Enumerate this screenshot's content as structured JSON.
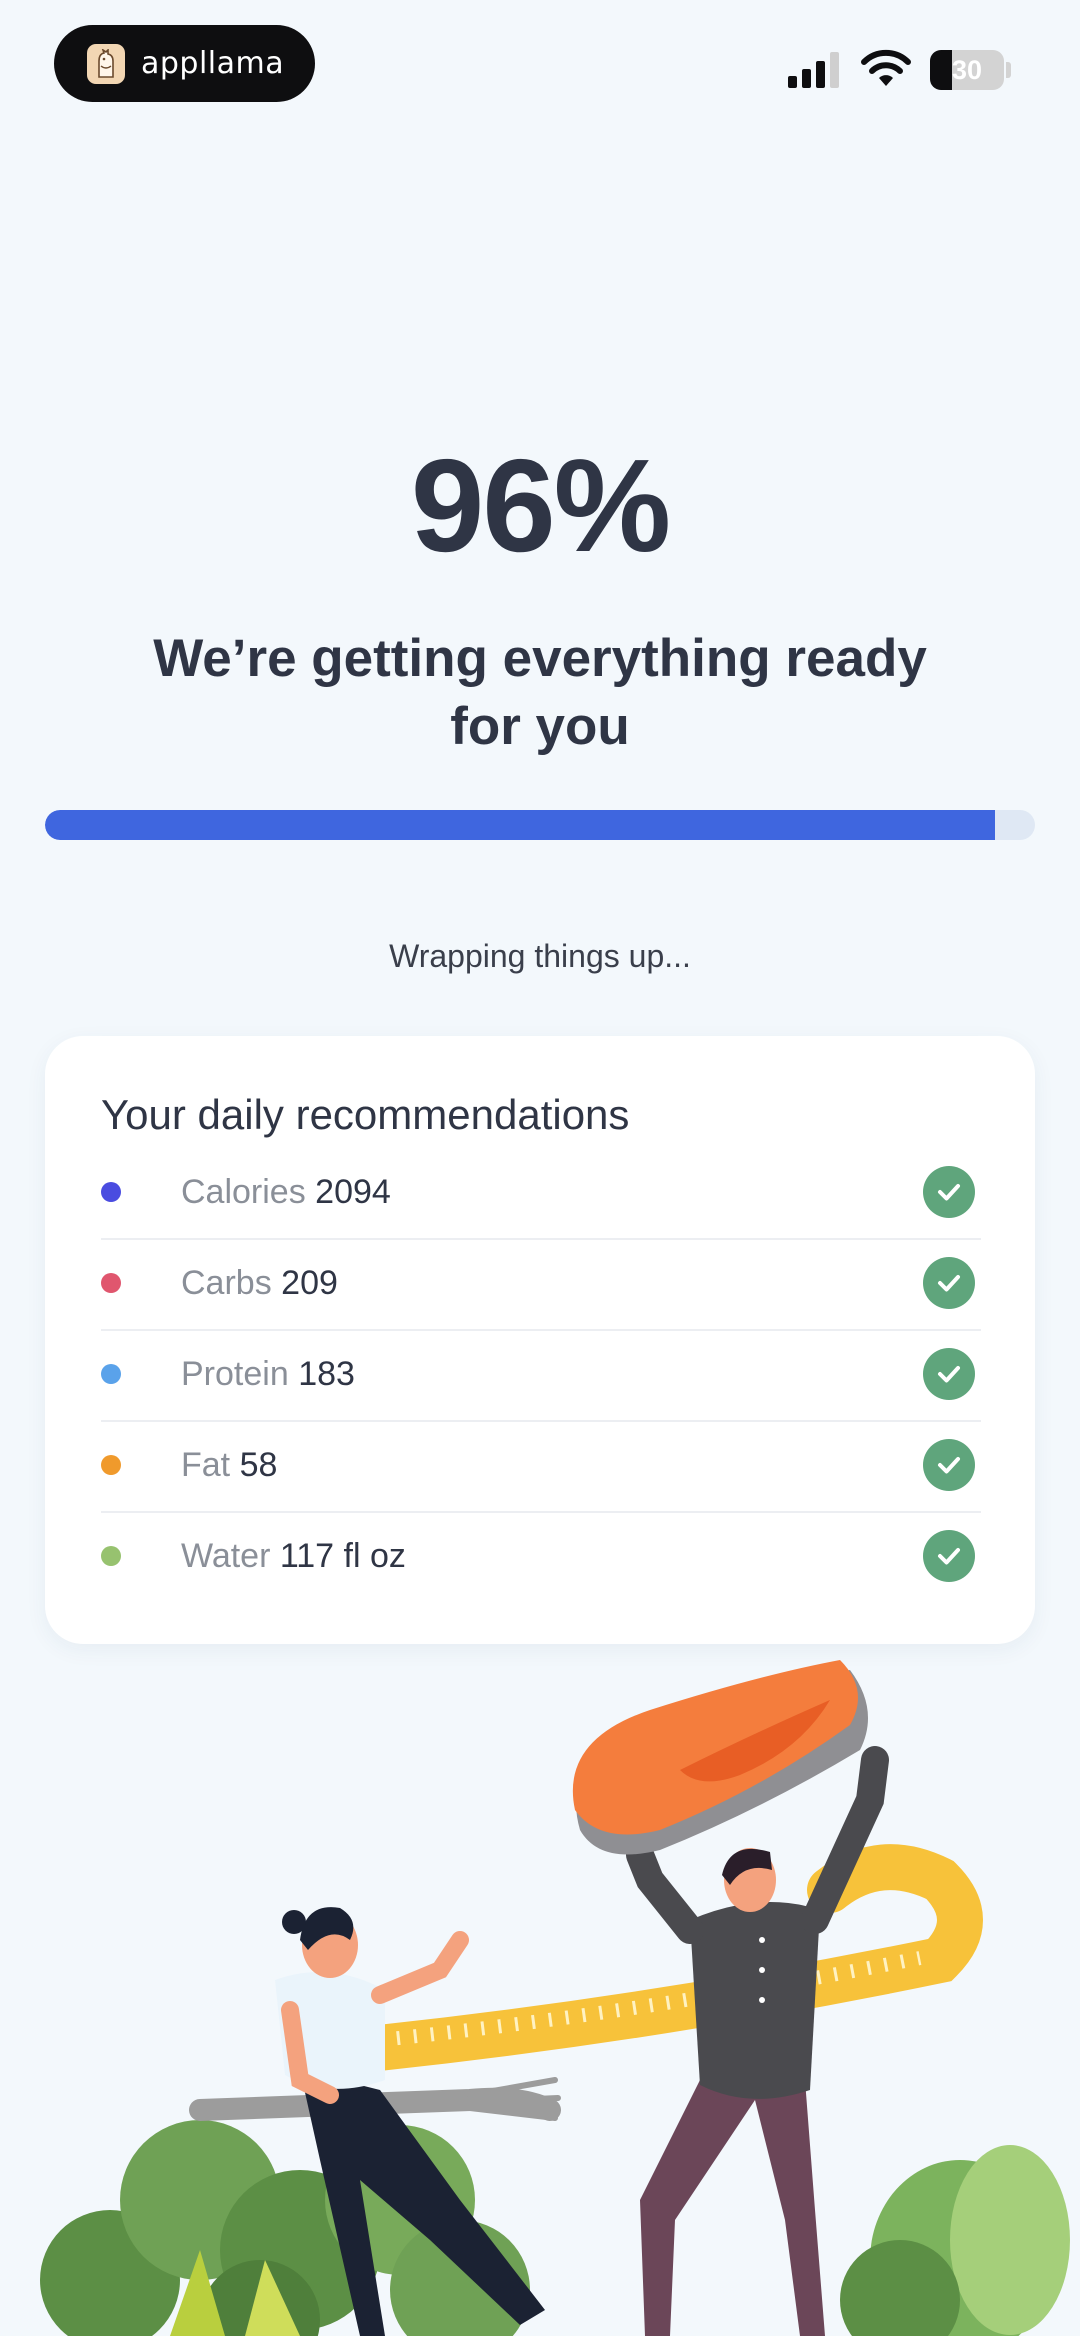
{
  "status_bar": {
    "app_name": "appllama",
    "battery": "30",
    "battery_level": 0.3,
    "icons": [
      "signal-icon",
      "wifi-icon",
      "battery-icon"
    ]
  },
  "progress": {
    "percent_text": "96%",
    "value": 0.96,
    "headline": "We’re getting everything ready for you",
    "status": "Wrapping things up..."
  },
  "recommendations": {
    "title": "Your daily recommendations",
    "items": [
      {
        "label": "Calories",
        "value": "2094",
        "color": "#4a4ce0"
      },
      {
        "label": "Carbs",
        "value": "209",
        "color": "#e0566e"
      },
      {
        "label": "Protein",
        "value": "183",
        "color": "#5aa2ea"
      },
      {
        "label": "Fat",
        "value": "58",
        "color": "#f09a2c"
      },
      {
        "label": "Water",
        "value": "117 fl oz",
        "color": "#97c26f"
      }
    ]
  },
  "colors": {
    "accent": "#3f66df",
    "check": "#5fa57c",
    "background": "#f3f8fc"
  }
}
